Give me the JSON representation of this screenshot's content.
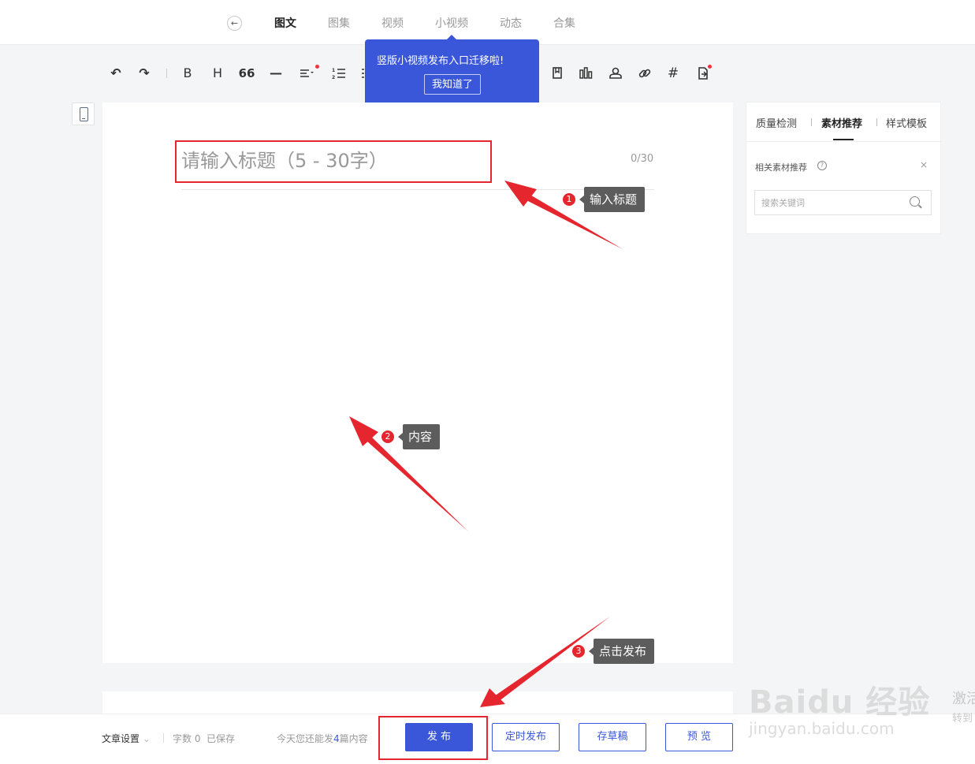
{
  "nav": {
    "back_icon": "arrow-left-icon",
    "tabs": [
      "图文",
      "图集",
      "视频",
      "小视频",
      "动态",
      "合集"
    ],
    "active_tab": "图文"
  },
  "toolbar": {
    "icons": [
      "undo-icon",
      "redo-icon",
      "bold-icon",
      "heading-icon",
      "quote-icon",
      "divider-icon",
      "align-icon",
      "ordered-list-icon",
      "unordered-list-icon",
      "bookmark-icon",
      "chart-icon",
      "user-icon",
      "link-icon",
      "hashtag-icon",
      "insert-doc-icon"
    ],
    "glyphs": {
      "bold": "B",
      "heading": "H",
      "quote": "66",
      "divider": "—",
      "hashtag": "#"
    }
  },
  "tooltip": {
    "message": "竖版小视频发布入口迁移啦!",
    "button": "我知道了"
  },
  "editor": {
    "title_placeholder": "请输入标题（5 - 30字）",
    "title_value": "",
    "char_count": "0/30"
  },
  "right_panel": {
    "tabs": [
      "质量检测",
      "素材推荐",
      "样式模板"
    ],
    "active_tab": "素材推荐",
    "section_title": "相关素材推荐",
    "help_glyph": "?",
    "close_glyph": "×",
    "search_placeholder": "搜索关键词"
  },
  "footer": {
    "settings": "文章设置",
    "word_count": "字数 0",
    "saved": "已保存",
    "quota_prefix": "今天您还能发",
    "quota_count": "4",
    "quota_suffix": "篇内容",
    "publish": "发 布",
    "schedule": "定时发布",
    "draft": "存草稿",
    "preview": "预 览"
  },
  "annotations": [
    {
      "num": "1",
      "label": "输入标题"
    },
    {
      "num": "2",
      "label": "内容"
    },
    {
      "num": "3",
      "label": "点击发布"
    }
  ],
  "watermark": {
    "logo": "Baidu 经验",
    "url": "jingyan.baidu.com",
    "right_line1": "激活",
    "right_line2": "转到"
  },
  "colors": {
    "accent": "#3a57d9",
    "annotation_red": "#e5262f",
    "annotation_label_bg": "#5c5c5c",
    "notification_dot": "#f0333d"
  }
}
